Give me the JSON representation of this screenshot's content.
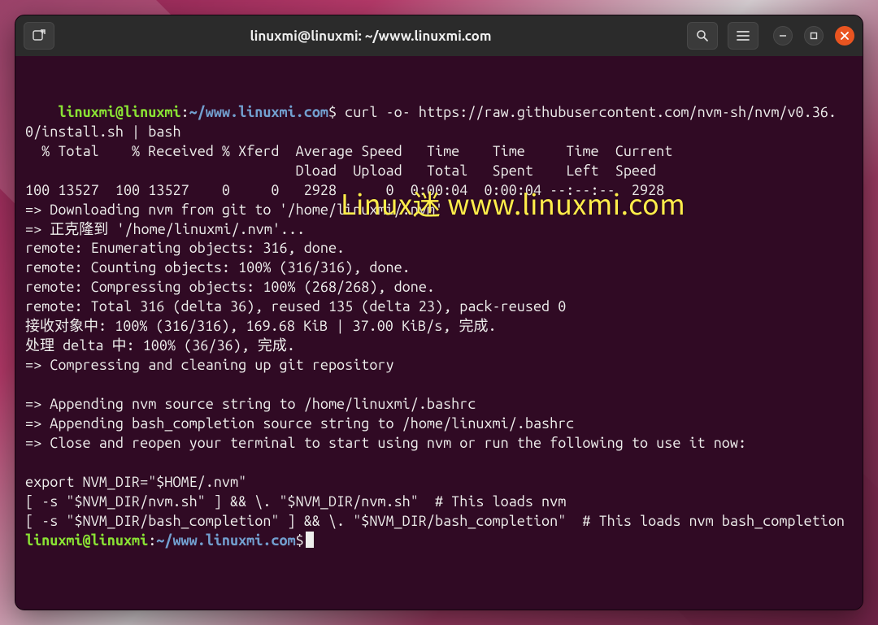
{
  "titlebar": {
    "title": "linuxmi@linuxmi: ~/www.linuxmi.com"
  },
  "prompt": {
    "user_host": "linuxmi@linuxmi",
    "sep": ":",
    "path": "~/www.linuxmi.com",
    "end": "$"
  },
  "command": " curl -o- https://raw.githubusercontent.com/nvm-sh/nvm/v0.36.0/install.sh | bash",
  "output_lines": [
    "  % Total    % Received % Xferd  Average Speed   Time    Time     Time  Current",
    "                                 Dload  Upload   Total   Spent    Left  Speed",
    "100 13527  100 13527    0     0   2928      0  0:00:04  0:00:04 --:--:--  2928",
    "=> Downloading nvm from git to '/home/linuxmi/.nvm'",
    "=> 正克隆到 '/home/linuxmi/.nvm'...",
    "remote: Enumerating objects: 316, done.",
    "remote: Counting objects: 100% (316/316), done.",
    "remote: Compressing objects: 100% (268/268), done.",
    "remote: Total 316 (delta 36), reused 135 (delta 23), pack-reused 0",
    "接收对象中: 100% (316/316), 169.68 KiB | 37.00 KiB/s, 完成.",
    "处理 delta 中: 100% (36/36), 完成.",
    "=> Compressing and cleaning up git repository",
    "",
    "=> Appending nvm source string to /home/linuxmi/.bashrc",
    "=> Appending bash_completion source string to /home/linuxmi/.bashrc",
    "=> Close and reopen your terminal to start using nvm or run the following to use it now:",
    "",
    "export NVM_DIR=\"$HOME/.nvm\"",
    "[ -s \"$NVM_DIR/nvm.sh\" ] && \\. \"$NVM_DIR/nvm.sh\"  # This loads nvm",
    "[ -s \"$NVM_DIR/bash_completion\" ] && \\. \"$NVM_DIR/bash_completion\"  # This loads nvm bash_completion"
  ],
  "watermark": "Linux迷 www.linuxmi.com"
}
